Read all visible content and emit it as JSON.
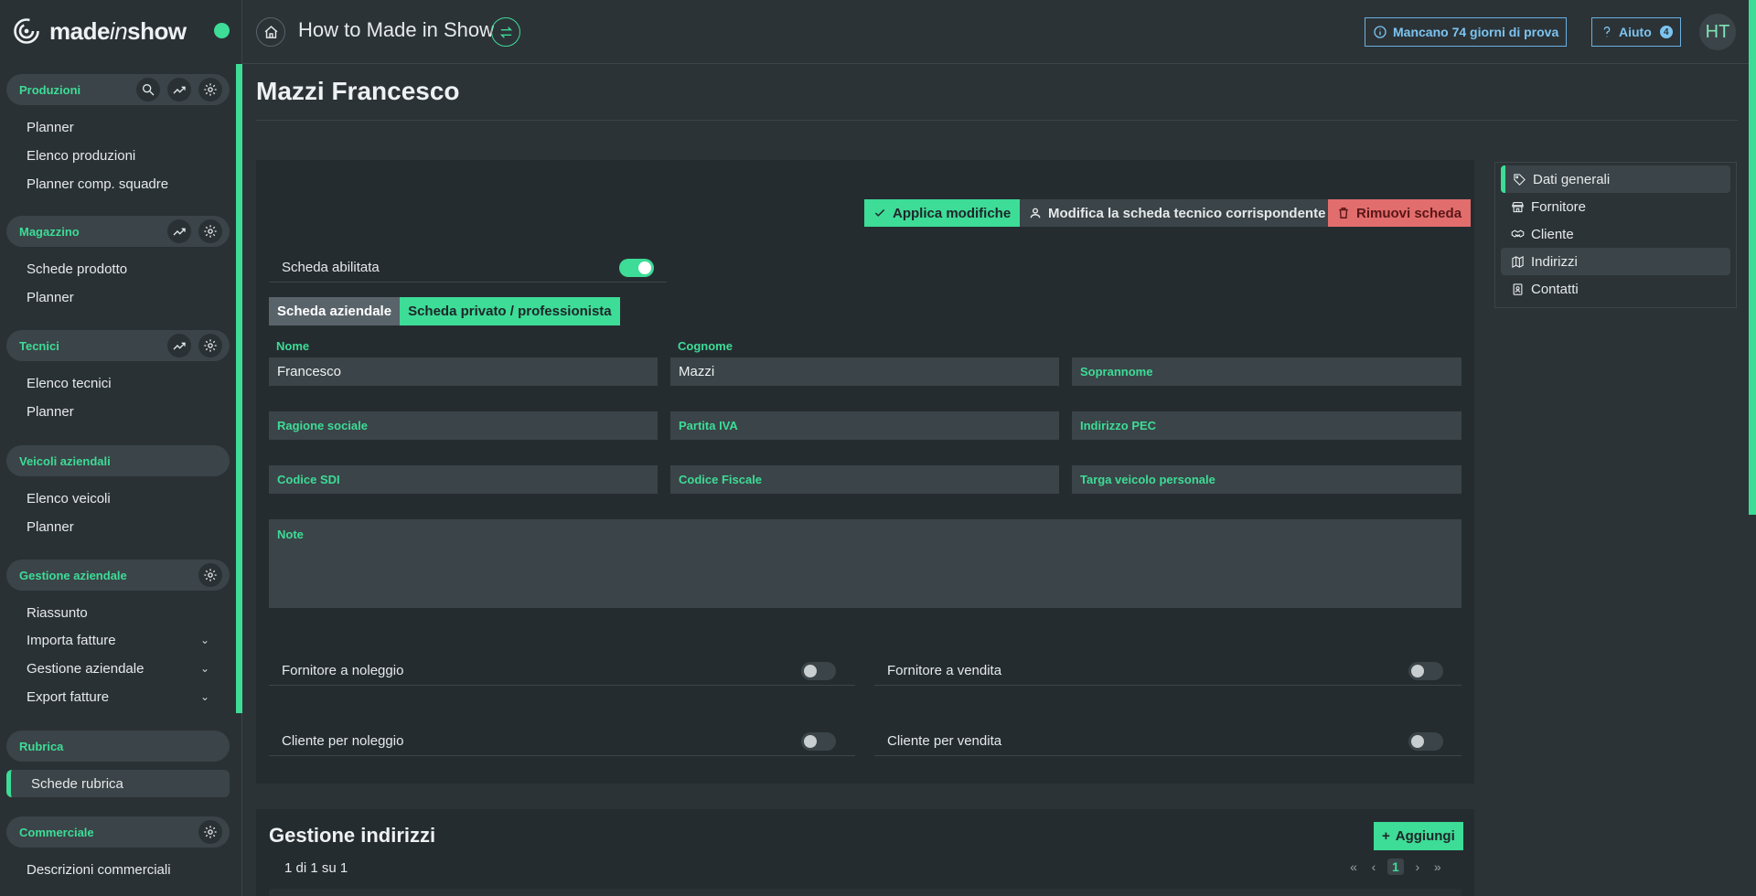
{
  "app": {
    "logo_prefix": "made",
    "logo_italic": "in",
    "logo_suffix": "show",
    "page_heading": "How to Made in Show"
  },
  "topbar": {
    "trial_text": "Mancano 74 giorni di prova",
    "help_label": "Aiuto",
    "help_badge": "4",
    "avatar_initials": "HT"
  },
  "sidebar": {
    "groups": [
      {
        "title": "Produzioni",
        "items": [
          "Planner",
          "Elenco produzioni",
          "Planner comp. squadre"
        ]
      },
      {
        "title": "Magazzino",
        "items": [
          "Schede prodotto",
          "Planner"
        ]
      },
      {
        "title": "Tecnici",
        "items": [
          "Elenco tecnici",
          "Planner"
        ]
      },
      {
        "title": "Veicoli aziendali",
        "items": [
          "Elenco veicoli",
          "Planner"
        ]
      },
      {
        "title": "Gestione aziendale",
        "items": [
          "Riassunto",
          "Importa fatture",
          "Gestione aziendale",
          "Export fatture"
        ]
      },
      {
        "title": "Rubrica",
        "items": [
          "Schede rubrica"
        ]
      },
      {
        "title": "Commerciale",
        "items": [
          "Descrizioni commerciali"
        ]
      }
    ]
  },
  "page": {
    "title": "Mazzi Francesco"
  },
  "actions": {
    "apply": "Applica modifiche",
    "edit_tech": "Modifica la scheda tecnico corrispondente",
    "remove": "Rimuovi scheda"
  },
  "form": {
    "enabled_label": "Scheda abilitata",
    "enabled": true,
    "tab_company": "Scheda aziendale",
    "tab_private": "Scheda privato / professionista",
    "nome_label": "Nome",
    "nome_value": "Francesco",
    "cognome_label": "Cognome",
    "cognome_value": "Mazzi",
    "soprannome_label": "Soprannome",
    "ragione_label": "Ragione sociale",
    "piva_label": "Partita IVA",
    "pec_label": "Indirizzo PEC",
    "sdi_label": "Codice SDI",
    "cf_label": "Codice Fiscale",
    "targa_label": "Targa veicolo personale",
    "note_label": "Note",
    "fornitore_noleggio": "Fornitore a noleggio",
    "fornitore_vendita": "Fornitore a vendita",
    "cliente_noleggio": "Cliente per noleggio",
    "cliente_vendita": "Cliente per vendita"
  },
  "right_panel": {
    "items": [
      "Dati generali",
      "Fornitore",
      "Cliente",
      "Indirizzi",
      "Contatti"
    ]
  },
  "addresses": {
    "title": "Gestione indirizzi",
    "add_label": "Aggiungi",
    "pagination_info": "1 di 1 su 1",
    "current_page": "1"
  },
  "colors": {
    "accent": "#3ddc97",
    "danger": "#e26d6d",
    "info": "#7cc4f0",
    "background": "#2c3337"
  }
}
